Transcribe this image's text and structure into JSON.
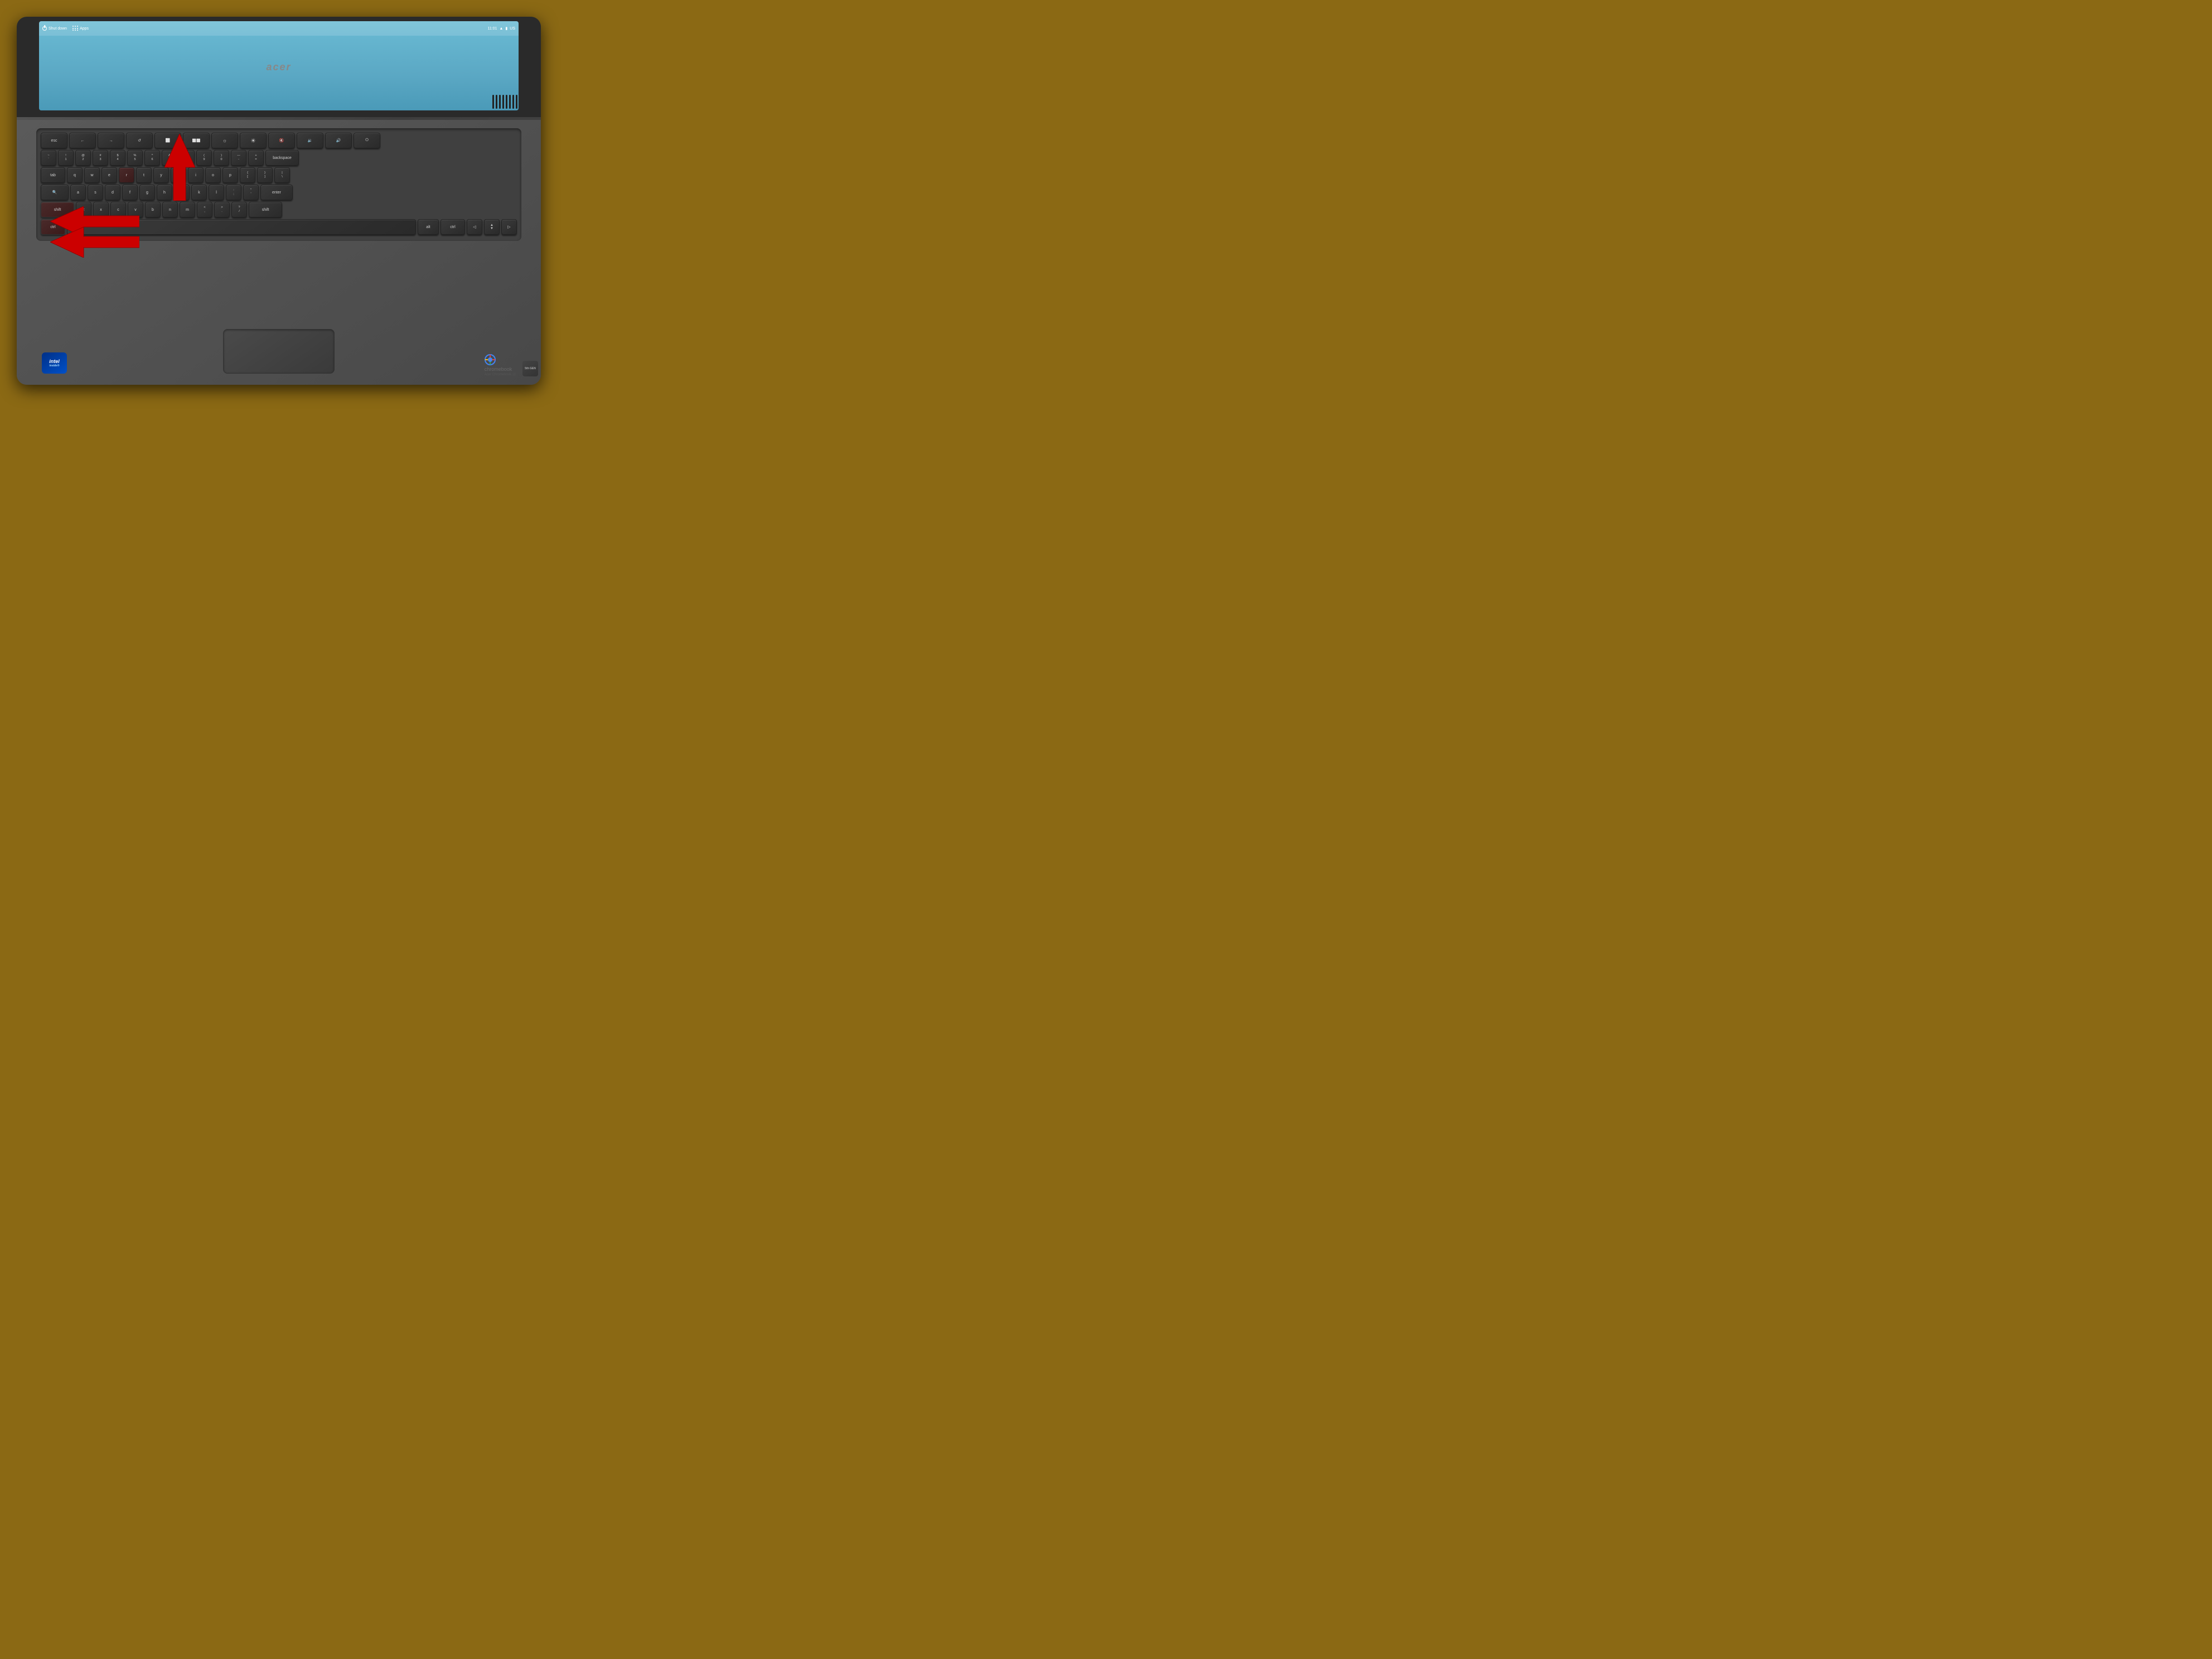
{
  "screen": {
    "taskbar": {
      "shutdown_label": "Shut down",
      "apps_label": "Apps",
      "time": "11:01",
      "wifi_icon": "wifi",
      "battery_icon": "battery",
      "locale": "US"
    }
  },
  "laptop": {
    "brand": "acer",
    "model_name": "chromebook",
    "model_number": "Acer Chromebook 11"
  },
  "keyboard": {
    "rows": [
      [
        "esc",
        "←",
        "→",
        "↺",
        "⬜",
        "⬜⬜",
        "⚙",
        "⚙",
        "🔇",
        "🔉",
        "⏏"
      ],
      [
        "~\n`",
        "!\n1",
        "@\n2",
        "#\n3",
        "$\n4",
        "%\n5",
        "^\n6",
        "&\n7",
        "*\n8",
        "(\n9",
        ")\n0",
        "—\n-",
        "+\n=",
        "backspace"
      ],
      [
        "tab",
        "q",
        "w",
        "e",
        "r",
        "t",
        "y",
        "u",
        "i",
        "o",
        "p",
        "[\n{",
        "]\n}",
        "\\\n|"
      ],
      [
        "🔍",
        "a",
        "s",
        "d",
        "f",
        "g",
        "h",
        "j",
        "k",
        "l",
        ":\n;",
        "\"\n'",
        "enter"
      ],
      [
        "shift",
        "z",
        "x",
        "c",
        "v",
        "b",
        "n",
        "m",
        "<\n,",
        ">\n.",
        "?\n/",
        "shift"
      ],
      [
        "ctrl",
        "",
        "",
        "",
        "",
        "",
        "",
        "",
        "",
        "alt",
        "ctrl",
        "◁",
        "▲\n▼",
        "▷"
      ]
    ]
  },
  "arrows": {
    "up_arrow": {
      "color": "#CC0000",
      "direction": "up",
      "target_key": "r"
    },
    "left_arrow_shift": {
      "color": "#CC0000",
      "direction": "left",
      "target_key": "shift"
    },
    "left_arrow_ctrl": {
      "color": "#CC0000",
      "direction": "left",
      "target_key": "ctrl"
    }
  },
  "badges": {
    "intel": {
      "brand": "intel",
      "line1": "intel",
      "line2": "inside"
    },
    "chromebook": {
      "text": "chromebook",
      "model": "Acer Chromebook 11"
    },
    "generation": "5th GEN"
  }
}
